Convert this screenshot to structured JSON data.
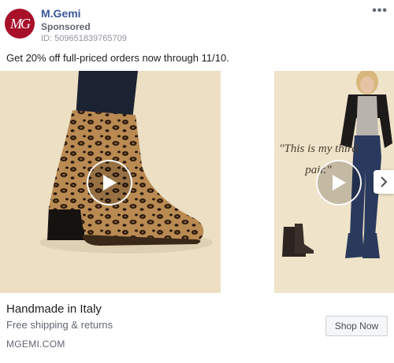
{
  "ad": {
    "advertiser": "M.Gemi",
    "avatar_text": "MG",
    "sponsored": "Sponsored",
    "ad_id": "ID: 509651839765709",
    "caption": "Get 20% off full-priced orders now through 11/10."
  },
  "carousel": {
    "cards": [
      {
        "media_type": "video"
      },
      {
        "media_type": "video",
        "quote": "\"This is my third pair.\""
      }
    ]
  },
  "footer": {
    "headline": "Handmade in Italy",
    "description": "Free shipping & returns",
    "domain": "MGEMI.COM",
    "cta_label": "Shop Now"
  },
  "colors": {
    "advertiser_link": "#385898",
    "avatar_bg": "#a8102a",
    "card_bg": "#ecdfc3"
  },
  "icons": {
    "more": "more-dots-icon",
    "play": "play-icon",
    "next": "chevron-right-icon"
  }
}
